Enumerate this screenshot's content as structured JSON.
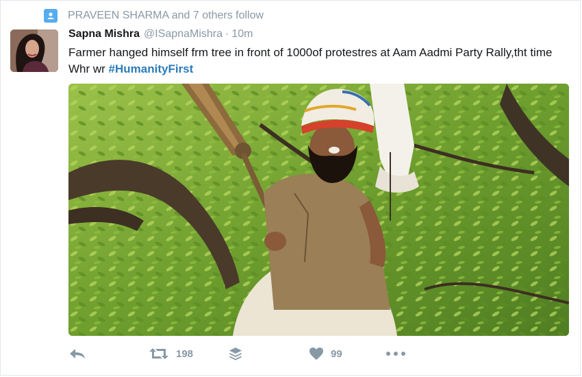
{
  "social_context": {
    "text": "PRAVEEN SHARMA and 7 others follow"
  },
  "tweet": {
    "fullname": "Sapna Mishra",
    "username": "@ISapnaMishra",
    "separator": "·",
    "timestamp": "10m",
    "text_plain": "Farmer hanged himself frm tree in front of 1000of protestres at Aam Aadmi Party Rally,tht time Whr wr ",
    "hashtag": "#HumanityFirst"
  },
  "actions": {
    "reply_icon": "reply-icon",
    "retweet_icon": "retweet-icon",
    "retweet_count": "198",
    "buffer_icon": "layers-icon",
    "like_icon": "heart-icon",
    "like_count": "99",
    "more_icon": "more-icon"
  },
  "colors": {
    "accent": "#55acee",
    "hashtag": "#2b7bb9",
    "muted": "#8899a6"
  }
}
